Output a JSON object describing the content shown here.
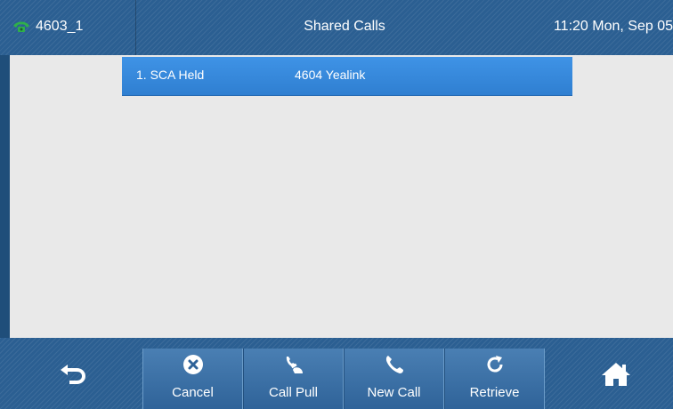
{
  "header": {
    "account": "4603_1",
    "title": "Shared Calls",
    "clock": "11:20 Mon, Sep 05"
  },
  "calls": [
    {
      "status": "1. SCA Held",
      "party": "4604 Yealink"
    }
  ],
  "softkeys": [
    {
      "label": "Cancel",
      "icon": "cancel-icon"
    },
    {
      "label": "Call Pull",
      "icon": "call-pull-icon"
    },
    {
      "label": "New Call",
      "icon": "new-call-icon"
    },
    {
      "label": "Retrieve",
      "icon": "retrieve-icon"
    }
  ],
  "colors": {
    "bar": "#2b5f92",
    "selected_row": "#3388dd",
    "content_bg": "#e9e9e9",
    "account_icon": "#2fb04a"
  }
}
